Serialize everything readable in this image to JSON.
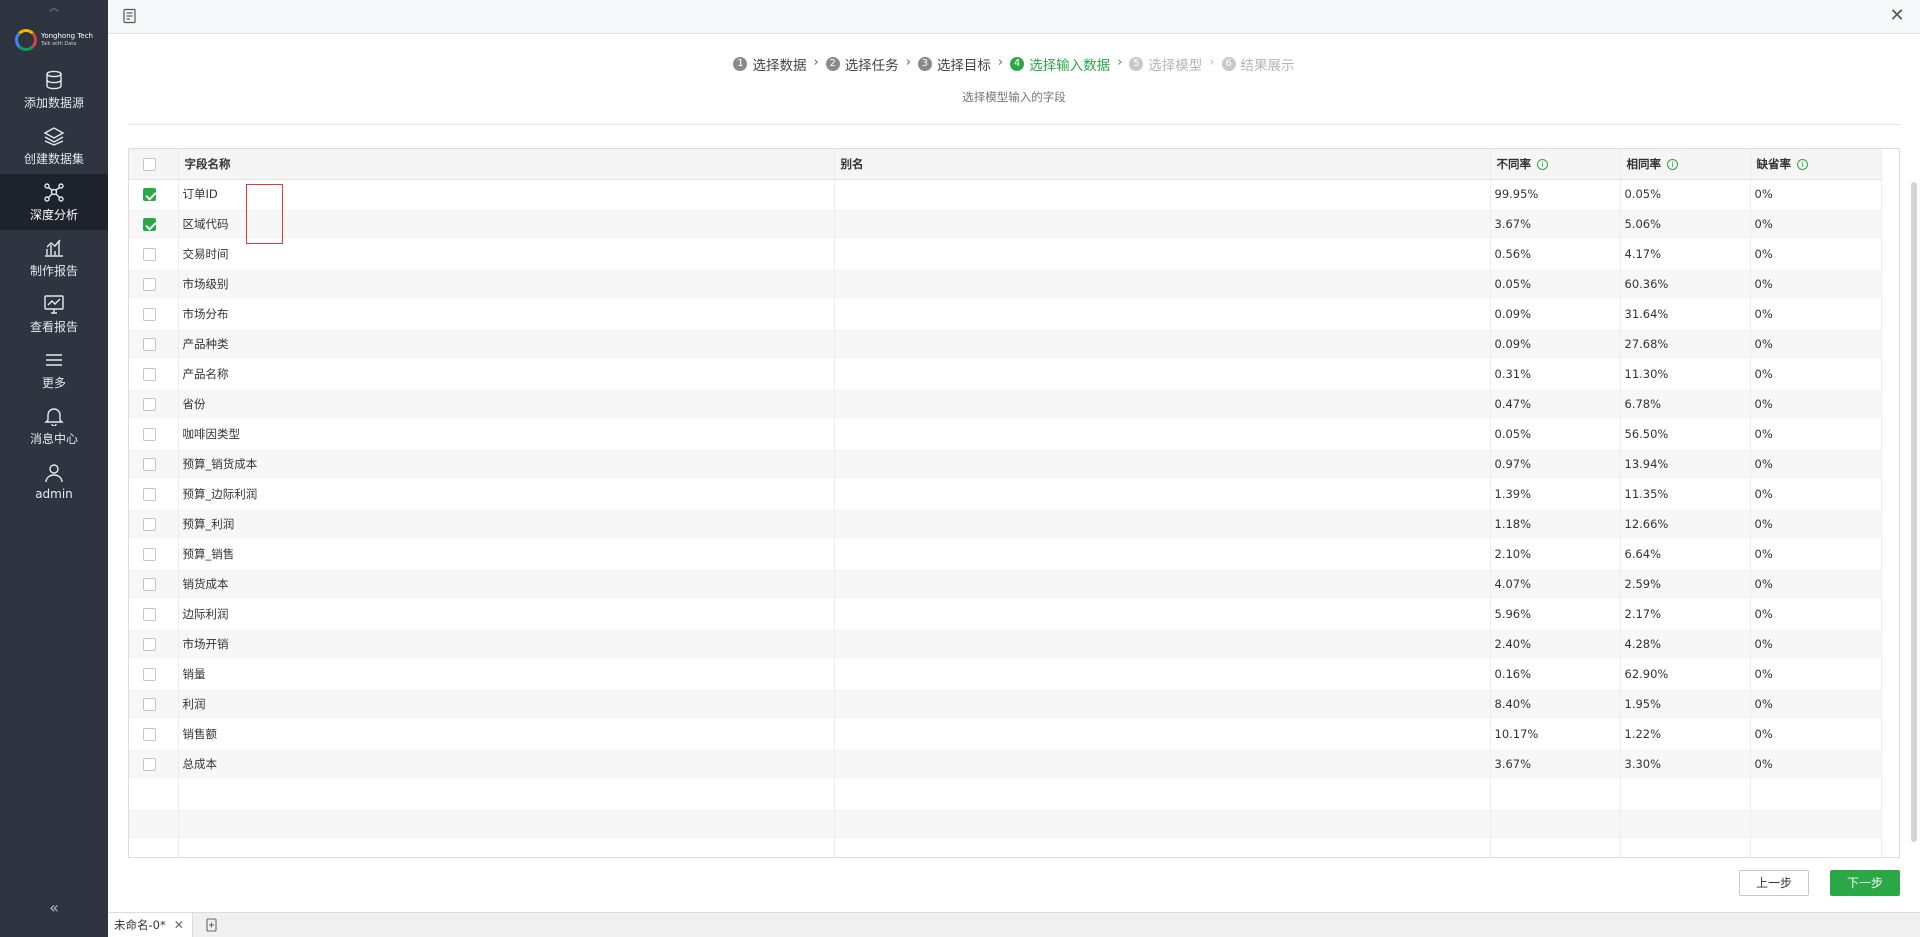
{
  "sidebar": {
    "logo": {
      "brand": "Yonghong Tech",
      "slogan": "Talk with Data"
    },
    "items": [
      {
        "label": "添加数据源",
        "icon": "database-icon"
      },
      {
        "label": "创建数据集",
        "icon": "layers-icon"
      },
      {
        "label": "深度分析",
        "icon": "network-icon",
        "active": true
      },
      {
        "label": "制作报告",
        "icon": "bar-chart-icon"
      },
      {
        "label": "查看报告",
        "icon": "line-chart-icon"
      },
      {
        "label": "更多",
        "icon": "menu-icon"
      },
      {
        "label": "消息中心",
        "icon": "bell-icon"
      },
      {
        "label": "admin",
        "icon": "user-icon"
      }
    ],
    "collapse_glyph": "«"
  },
  "topbar": {
    "close_glyph": "✕"
  },
  "steps": [
    {
      "num": "1",
      "label": "选择数据",
      "state": "done"
    },
    {
      "num": "2",
      "label": "选择任务",
      "state": "done"
    },
    {
      "num": "3",
      "label": "选择目标",
      "state": "done"
    },
    {
      "num": "4",
      "label": "选择输入数据",
      "state": "active"
    },
    {
      "num": "5",
      "label": "选择模型",
      "state": "future"
    },
    {
      "num": "6",
      "label": "结果展示",
      "state": "future"
    }
  ],
  "subtitle": "选择模型输入的字段",
  "table": {
    "headers": {
      "name": "字段名称",
      "alias": "别名",
      "diff": "不同率",
      "same": "相同率",
      "missing": "缺省率"
    },
    "rows": [
      {
        "checked": true,
        "name": "订单ID",
        "alias": "",
        "diff": "99.95%",
        "same": "0.05%",
        "missing": "0%"
      },
      {
        "checked": true,
        "name": "区域代码",
        "alias": "",
        "diff": "3.67%",
        "same": "5.06%",
        "missing": "0%"
      },
      {
        "checked": false,
        "name": "交易时间",
        "alias": "",
        "diff": "0.56%",
        "same": "4.17%",
        "missing": "0%"
      },
      {
        "checked": false,
        "name": "市场级别",
        "alias": "",
        "diff": "0.05%",
        "same": "60.36%",
        "missing": "0%"
      },
      {
        "checked": false,
        "name": "市场分布",
        "alias": "",
        "diff": "0.09%",
        "same": "31.64%",
        "missing": "0%"
      },
      {
        "checked": false,
        "name": "产品种类",
        "alias": "",
        "diff": "0.09%",
        "same": "27.68%",
        "missing": "0%"
      },
      {
        "checked": false,
        "name": "产品名称",
        "alias": "",
        "diff": "0.31%",
        "same": "11.30%",
        "missing": "0%"
      },
      {
        "checked": false,
        "name": "省份",
        "alias": "",
        "diff": "0.47%",
        "same": "6.78%",
        "missing": "0%"
      },
      {
        "checked": false,
        "name": "咖啡因类型",
        "alias": "",
        "diff": "0.05%",
        "same": "56.50%",
        "missing": "0%"
      },
      {
        "checked": false,
        "name": "预算_销货成本",
        "alias": "",
        "diff": "0.97%",
        "same": "13.94%",
        "missing": "0%"
      },
      {
        "checked": false,
        "name": "预算_边际利润",
        "alias": "",
        "diff": "1.39%",
        "same": "11.35%",
        "missing": "0%"
      },
      {
        "checked": false,
        "name": "预算_利润",
        "alias": "",
        "diff": "1.18%",
        "same": "12.66%",
        "missing": "0%"
      },
      {
        "checked": false,
        "name": "预算_销售",
        "alias": "",
        "diff": "2.10%",
        "same": "6.64%",
        "missing": "0%"
      },
      {
        "checked": false,
        "name": "销货成本",
        "alias": "",
        "diff": "4.07%",
        "same": "2.59%",
        "missing": "0%"
      },
      {
        "checked": false,
        "name": "边际利润",
        "alias": "",
        "diff": "5.96%",
        "same": "2.17%",
        "missing": "0%"
      },
      {
        "checked": false,
        "name": "市场开销",
        "alias": "",
        "diff": "2.40%",
        "same": "4.28%",
        "missing": "0%"
      },
      {
        "checked": false,
        "name": "销量",
        "alias": "",
        "diff": "0.16%",
        "same": "62.90%",
        "missing": "0%"
      },
      {
        "checked": false,
        "name": "利润",
        "alias": "",
        "diff": "8.40%",
        "same": "1.95%",
        "missing": "0%"
      },
      {
        "checked": false,
        "name": "销售额",
        "alias": "",
        "diff": "10.17%",
        "same": "1.22%",
        "missing": "0%"
      },
      {
        "checked": false,
        "name": "总成本",
        "alias": "",
        "diff": "3.67%",
        "same": "3.30%",
        "missing": "0%"
      }
    ]
  },
  "buttons": {
    "prev": "上一步",
    "next": "下一步"
  },
  "tabbar": {
    "tab_label": "未命名-0*",
    "tab_close": "✕"
  },
  "colors": {
    "accent": "#2aa845",
    "sidebar_bg": "#2e3440",
    "highlight": "#e03a3a"
  }
}
